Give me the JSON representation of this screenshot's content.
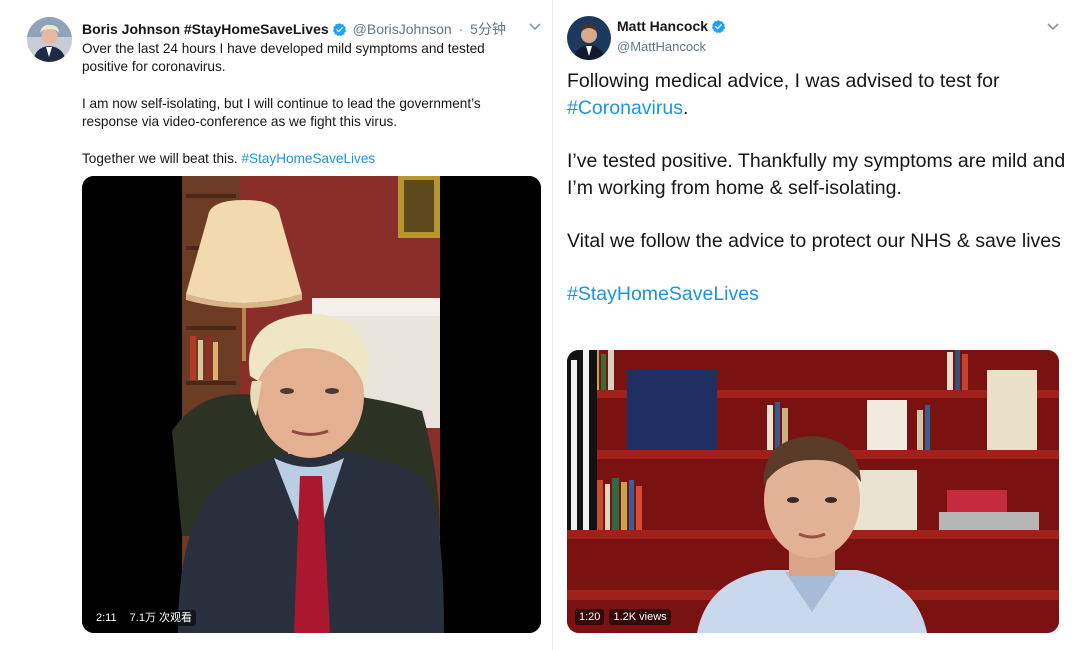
{
  "left_tweet": {
    "name": "Boris Johnson #StayHomeSaveLives",
    "handle": "@BorisJohnson",
    "separator": "·",
    "time": "5分钟",
    "paragraph1": "Over the last 24 hours I have developed mild symptoms and tested positive for coronavirus.",
    "paragraph2": "I am now self-isolating, but I will continue to lead the government’s response via video-conference as we fight this virus.",
    "paragraph3_text": "Together we will beat this.",
    "paragraph3_hashtag": "#StayHomeSaveLives",
    "video": {
      "duration": "2:11",
      "views": "7.1万 次观看"
    }
  },
  "right_tweet": {
    "name": "Matt Hancock",
    "handle": "@MattHancock",
    "paragraph1_text": "Following medical advice, I was advised to test for",
    "paragraph1_hashtag": "#Coronavirus",
    "paragraph1_end": ".",
    "paragraph2": "I’ve tested positive. Thankfully my symptoms are mild and I’m working from home & self-isolating.",
    "paragraph3": "Vital we follow the advice to protect our NHS & save lives",
    "hashtag": "#StayHomeSaveLives",
    "video": {
      "duration": "1:20",
      "views": "1.2K views"
    }
  },
  "colors": {
    "link": "#1b95e0",
    "verified": "#1da1f2",
    "muted": "#657786",
    "text": "#14171a"
  },
  "icons": [
    "verified-badge-icon",
    "chevron-down-icon"
  ]
}
